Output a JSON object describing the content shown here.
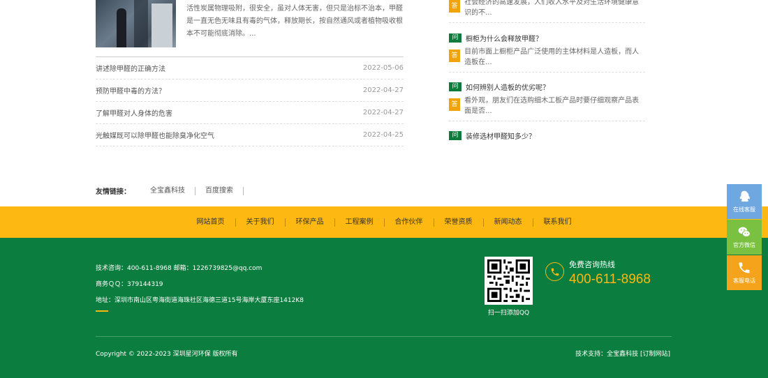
{
  "news": {
    "excerpt": "活性炭属物理吸附，很安全，虽对人体无害，但只是治标不治本，甲醛是一直无色无味且有毒的气体，释放期长，按自然通风或者植物吸收根本不可能彻底消除。...",
    "items": [
      {
        "title": "讲述除甲醛的正确方法",
        "date": "2022-05-06"
      },
      {
        "title": "预防甲醛中毒的方法？",
        "date": "2022-04-27"
      },
      {
        "title": "了解甲醛对人身体的危害",
        "date": "2022-04-27"
      },
      {
        "title": "光触媒既可以除甲醛也能除臭净化空气",
        "date": "2022-04-25"
      }
    ]
  },
  "qa": {
    "q_badge": "问",
    "a_badge": "答",
    "items": [
      {
        "answer": "社会经济的高速发展，人们收入水平及对生活环境健康意识的不..."
      },
      {
        "question": "橱柜为什么会释放甲醛？",
        "answer": "目前市面上橱柜产品广泛使用的主体材料是人造板，而人造板在..."
      },
      {
        "question": "如何辨别人造板的优劣呢？",
        "answer": "看外观，朋友们在选购细木工板产品时要仔细观察产品表面是否..."
      },
      {
        "question": "装修选材甲醛知多少？"
      }
    ]
  },
  "friend_links": {
    "title": "友情链接：",
    "items": [
      "全宝鑫科技",
      "百度搜索"
    ]
  },
  "nav": [
    "网站首页",
    "关于我们",
    "环保产品",
    "工程案例",
    "合作伙伴",
    "荣誉资质",
    "新闻动态",
    "联系我们"
  ],
  "footer": {
    "contact_line1": "技术咨询：400-611-8968   邮箱：1226739825@qq.com",
    "contact_line2": "商务ＱＱ：379144319",
    "contact_line3": "地址：深圳市南山区粤海街道海珠社区海德三道15号海岸大厦东座1412K8",
    "qr_caption": "扫一扫添加QQ",
    "hotline_label": "免费咨询热线",
    "hotline_number": "400-611-8968",
    "copyright": "Copyright © 2022-2023 深圳星河环保 版权所有",
    "support": "技术支持：全宝鑫科技 [订制网站]"
  },
  "side_buttons": [
    {
      "label": "在线客服",
      "icon": "qq-icon"
    },
    {
      "label": "官方微信",
      "icon": "wechat-icon"
    },
    {
      "label": "客服电话",
      "icon": "phone-icon"
    }
  ],
  "colors": {
    "green": "#0b7d3e",
    "yellow": "#fdb812",
    "qa_q_badge": "#0e7a3b",
    "qa_a_badge": "#f0a30a"
  }
}
